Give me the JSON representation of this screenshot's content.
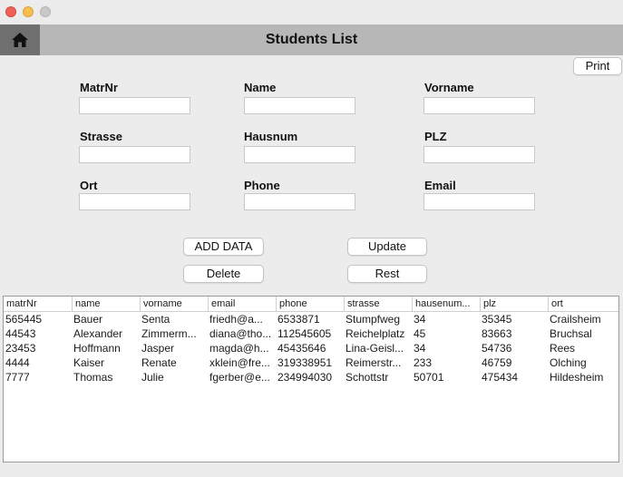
{
  "header": {
    "title": "Students List"
  },
  "toolbar": {
    "print_label": "Print"
  },
  "form": {
    "matrnr_label": "MatrNr",
    "name_label": "Name",
    "vorname_label": "Vorname",
    "strasse_label": "Strasse",
    "hausnum_label": "Hausnum",
    "plz_label": "PLZ",
    "ort_label": "Ort",
    "phone_label": "Phone",
    "email_label": "Email"
  },
  "actions": {
    "add_label": "ADD DATA",
    "update_label": "Update",
    "delete_label": "Delete",
    "reset_label": "Rest"
  },
  "table": {
    "columns": [
      "matrNr",
      "name",
      "vorname",
      "email",
      "phone",
      "strasse",
      "hausenum...",
      "plz",
      "ort"
    ],
    "rows": [
      [
        "565445",
        "Bauer",
        "Senta",
        " friedh@a...",
        "6533871",
        "Stumpfweg",
        "34",
        "35345",
        "Crailsheim"
      ],
      [
        "44543",
        "Alexander",
        "Zimmerm...",
        "diana@tho...",
        "112545605",
        "Reichelplatz",
        "45",
        "83663",
        "Bruchsal"
      ],
      [
        "23453",
        "Hoffmann",
        "Jasper",
        "magda@h...",
        "45435646",
        "Lina-Geisl...",
        "34",
        "54736",
        "Rees"
      ],
      [
        "4444",
        "Kaiser",
        "Renate",
        "xklein@fre...",
        "319338951",
        "Reimerstr...",
        "233",
        "46759",
        "Olching"
      ],
      [
        "7777",
        "Thomas",
        "Julie",
        "fgerber@e...",
        "234994030",
        "Schottstr",
        "50701",
        "475434",
        "Hildesheim"
      ]
    ]
  }
}
